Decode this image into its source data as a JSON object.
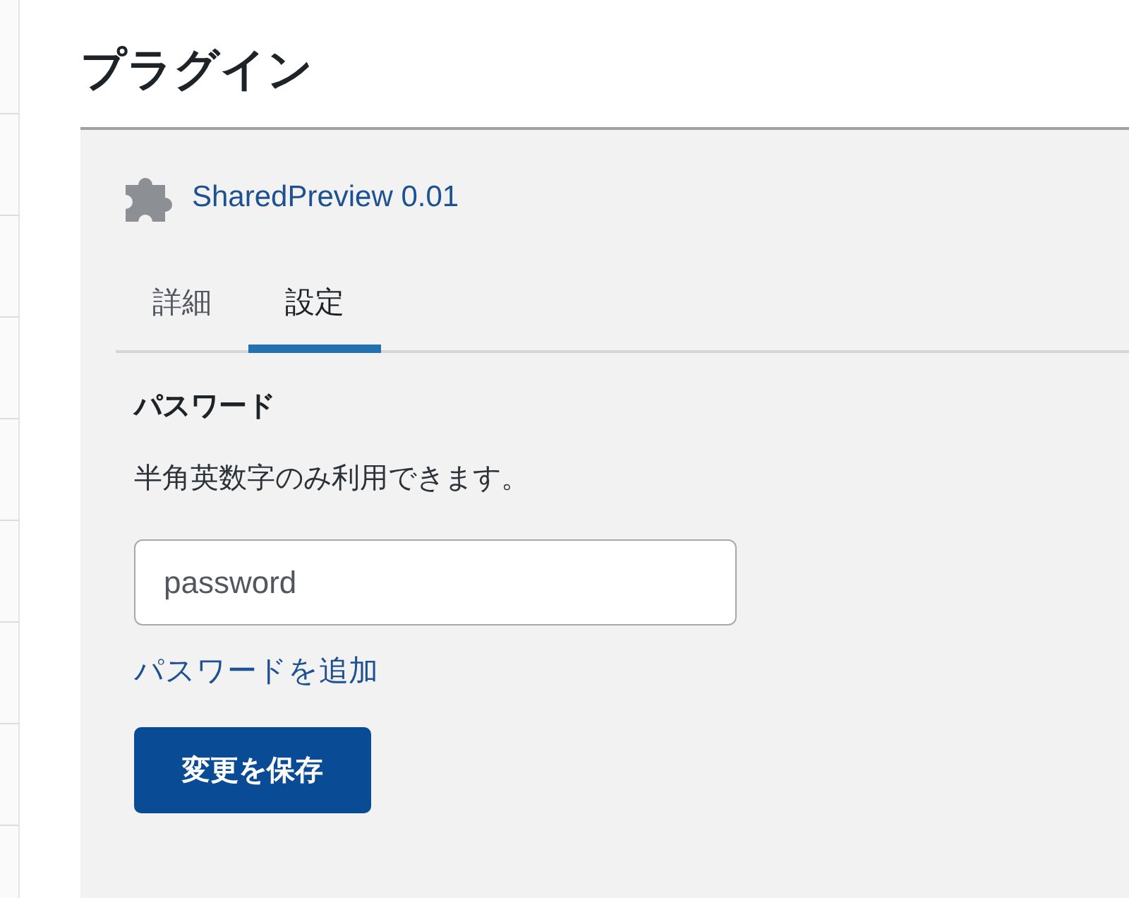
{
  "page_title": "プラグイン",
  "plugin": {
    "name": "SharedPreview 0.01"
  },
  "tabs": [
    {
      "label": "詳細",
      "selected": false
    },
    {
      "label": "設定",
      "selected": true
    }
  ],
  "section": {
    "heading": "パスワード",
    "description": "半角英数字のみ利用できます。"
  },
  "password_field": {
    "placeholder": "password"
  },
  "add_link": "パスワードを追加",
  "save_button": "変更を保存"
}
